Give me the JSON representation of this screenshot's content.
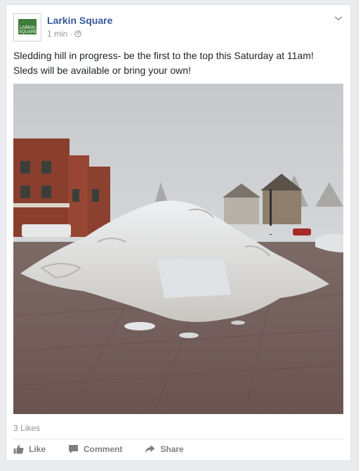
{
  "post": {
    "page_name": "Larkin Square",
    "timestamp": "1 min",
    "separator": "·",
    "avatar_text": "LARKIN SQUARE",
    "text_line1": "Sledding hill in progress- be the first to the top this Saturday at 11am!",
    "text_line2": "Sleds will be available or bring your own!",
    "likes_count": "3 Likes"
  },
  "actions": {
    "like_label": "Like",
    "comment_label": "Comment",
    "share_label": "Share"
  },
  "colors": {
    "link_blue": "#365899",
    "meta_gray": "#90949c",
    "action_gray": "#7f7f7f",
    "brand_green": "#3f7d3a"
  }
}
